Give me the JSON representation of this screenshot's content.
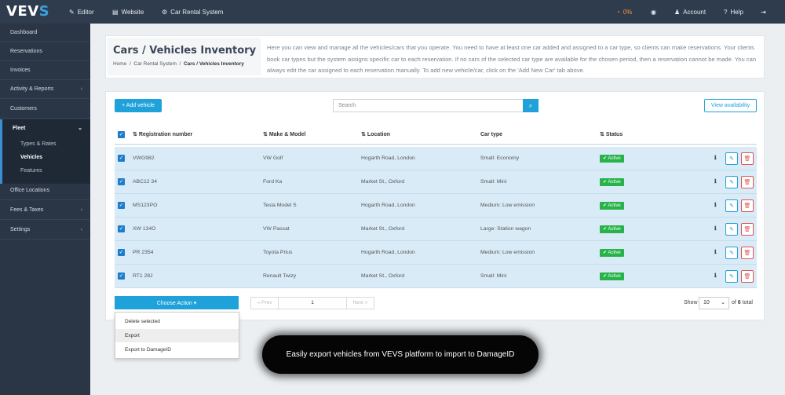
{
  "topbar": {
    "logo_main": "VEV",
    "logo_accent": "S",
    "nav": [
      {
        "icon": "pencil-icon",
        "glyph": "✎",
        "label": "Editor"
      },
      {
        "icon": "website-icon",
        "glyph": "▤",
        "label": "Website"
      },
      {
        "icon": "gear-icon",
        "glyph": "⚙",
        "label": "Car Rental System"
      }
    ],
    "progress": "0%",
    "account": "Account",
    "help": "Help"
  },
  "sidebar": {
    "items": [
      "Dashboard",
      "Reservations",
      "Invoices",
      "Activity & Reports",
      "Customers"
    ],
    "fleet": "Fleet",
    "fleet_sub": [
      "Types & Rates",
      "Vehicles",
      "Features"
    ],
    "items_after": [
      "Office Locations",
      "Fees & Taxes",
      "Settings"
    ]
  },
  "header": {
    "title": "Cars / Vehicles Inventory",
    "breadcrumb": [
      "Home",
      "Car Rental System",
      "Cars / Vehicles Inventory"
    ],
    "description": "Here you can view and manage all the vehicles/cars that you operate. You need to have at least one car added and assigned to a car type, so clients can make reservations. Your clients book car types but the system assigns specific car to each reservation. If no cars of the selected car type are available for the chosen period, then a reservation cannot be made. You can always edit the car assigned to each reservation manually. To add new vehicle/car, click on the 'Add New Car' tab above."
  },
  "toolbar": {
    "add_label": "+ Add vehicle",
    "search_placeholder": "Search",
    "availability_label": "View availability"
  },
  "table": {
    "columns": [
      "Registration number",
      "Make & Model",
      "Location",
      "Car type",
      "Status"
    ],
    "rows": [
      {
        "reg": "VWG982",
        "model": "VW Golf",
        "location": "Hogarth Road, London",
        "type": "Small: Economy",
        "status": "Active"
      },
      {
        "reg": "ABC12 34",
        "model": "Ford Ka",
        "location": "Market St., Oxford",
        "type": "Small: Mini",
        "status": "Active"
      },
      {
        "reg": "MS123PO",
        "model": "Tesla Model S",
        "location": "Hogarth Road, London",
        "type": "Medium: Low emission",
        "status": "Active"
      },
      {
        "reg": "XW 134O",
        "model": "VW Passat",
        "location": "Market St., Oxford",
        "type": "Large: Station wagon",
        "status": "Active"
      },
      {
        "reg": "PR 2354",
        "model": "Toyota Prius",
        "location": "Hogarth Road, London",
        "type": "Medium: Low emission",
        "status": "Active"
      },
      {
        "reg": "RT1 28J",
        "model": "Renault Twizy",
        "location": "Market St., Oxford",
        "type": "Small: Mini",
        "status": "Active"
      }
    ]
  },
  "footer": {
    "choose_action": "Choose Action ▾",
    "actions": [
      "Delete selected",
      "Export",
      "Export to DamageID"
    ],
    "prev": "« Prev",
    "page": "1",
    "next": "Next »",
    "show": "Show",
    "per_page": "10",
    "of": "of",
    "total_pages": "6",
    "total": "total"
  },
  "tooltip": "Easily export vehicles from VEVS platform to import to DamageID",
  "colors": {
    "accent": "#1fa2d9",
    "sidebar": "#2a3646",
    "active": "#27b24a",
    "danger": "#e05555"
  }
}
